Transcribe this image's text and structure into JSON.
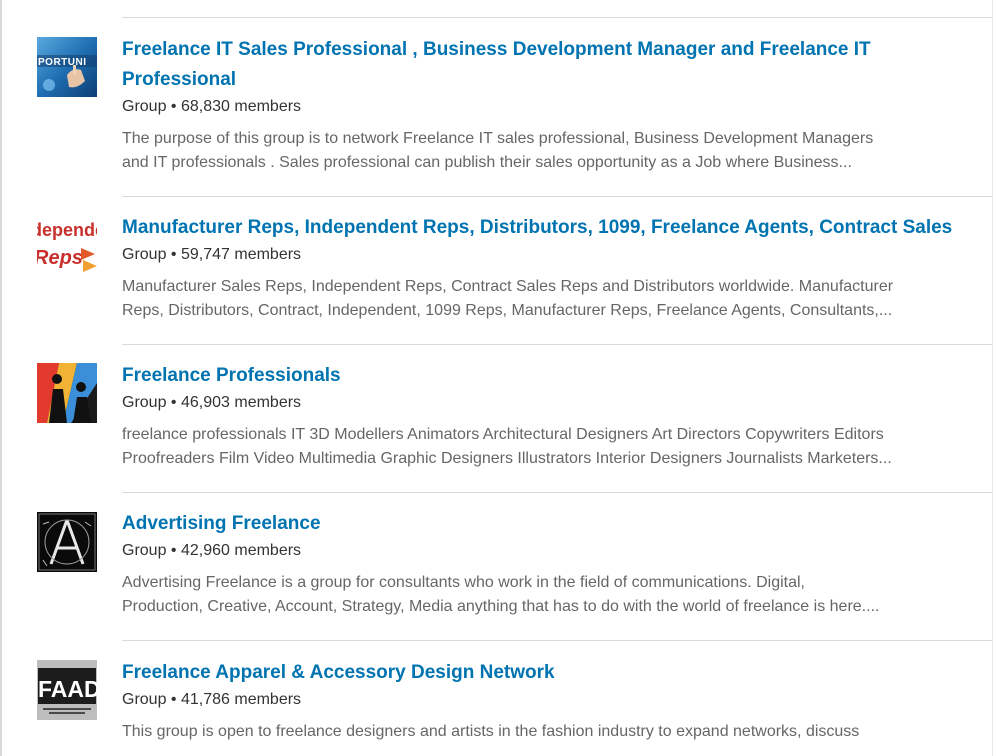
{
  "results": [
    {
      "title": "Freelance IT Sales Professional , Business Development Manager and Freelance IT Professional",
      "type": "Group",
      "members": "68,830 members",
      "description_line1": "The purpose of this group is to network Freelance IT sales professional, Business Development Managers",
      "description_line2": "and IT professionals . Sales professional can publish their sales opportunity as a Job where Business...",
      "thumb_text": "PORTUNI"
    },
    {
      "title": "Manufacturer Reps, Independent Reps, Distributors, 1099, Freelance Agents, Contract Sales",
      "type": "Group",
      "members": "59,747 members",
      "description_line1": "Manufacturer Sales Reps, Independent Reps, Contract Sales Reps and Distributors worldwide. Manufacturer",
      "description_line2": "Reps, Distributors, Contract, Independent, 1099 Reps, Manufacturer Reps, Freelance Agents, Consultants,...",
      "thumb_text_1": "depende",
      "thumb_text_2": "Reps"
    },
    {
      "title": "Freelance Professionals",
      "type": "Group",
      "members": "46,903 members",
      "description_line1": "freelance professionals IT 3D Modellers Animators Architectural Designers Art Directors Copywriters Editors",
      "description_line2": "Proofreaders Film Video Multimedia Graphic Designers Illustrators Interior Designers Journalists Marketers..."
    },
    {
      "title": "Advertising Freelance",
      "type": "Group",
      "members": "42,960 members",
      "description_line1": "Advertising Freelance is a group for consultants who work in the field of communications. Digital,",
      "description_line2": "Production, Creative, Account, Strategy, Media anything that has to do with the world of freelance is here...."
    },
    {
      "title": "Freelance Apparel & Accessory Design Network",
      "type": "Group",
      "members": "41,786 members",
      "description_line1": "This group is open to freelance designers and artists in the fashion industry to expand networks, discuss",
      "thumb_text": "FAAD"
    }
  ],
  "colors": {
    "link": "#0073b1",
    "meta": "#333333",
    "description": "#666666",
    "divider": "#dadada"
  },
  "bullet": "•"
}
